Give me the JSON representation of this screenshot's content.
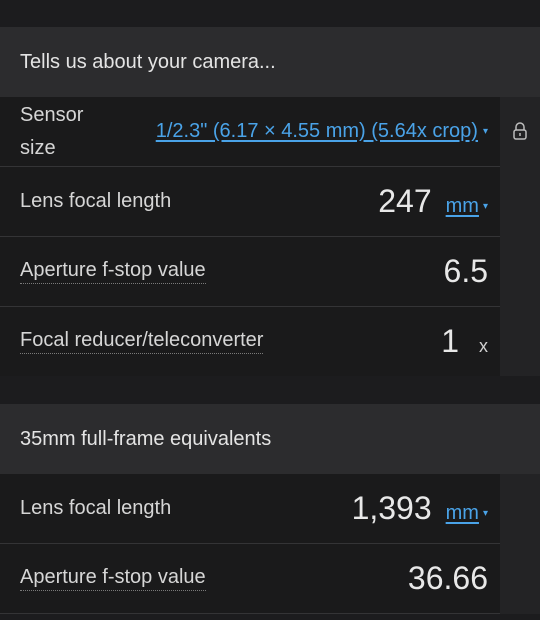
{
  "camera_section": {
    "header": "Tells us about your camera...",
    "sensor": {
      "label_line1": "Sensor",
      "label_line2": "size",
      "value": "1/2.3\" (6.17 × 4.55 mm) (5.64x crop)",
      "caret": "▾"
    },
    "focal_length": {
      "label": "Lens focal length",
      "value": "247",
      "unit": "mm",
      "caret": "▾"
    },
    "aperture": {
      "label": "Aperture f-stop value",
      "value": "6.5"
    },
    "reducer": {
      "label": "Focal reducer/teleconverter",
      "value": "1",
      "unit": "x"
    },
    "lock_icon": "lock-icon"
  },
  "equivalents_section": {
    "header": "35mm full-frame equivalents",
    "focal_length": {
      "label": "Lens focal length",
      "value": "1,393",
      "unit": "mm",
      "caret": "▾"
    },
    "aperture": {
      "label": "Aperture f-stop value",
      "value": "36.66"
    }
  },
  "colors": {
    "link": "#4aa3e8",
    "background": "#1c1c1e",
    "header_bg": "#2c2c2e"
  }
}
